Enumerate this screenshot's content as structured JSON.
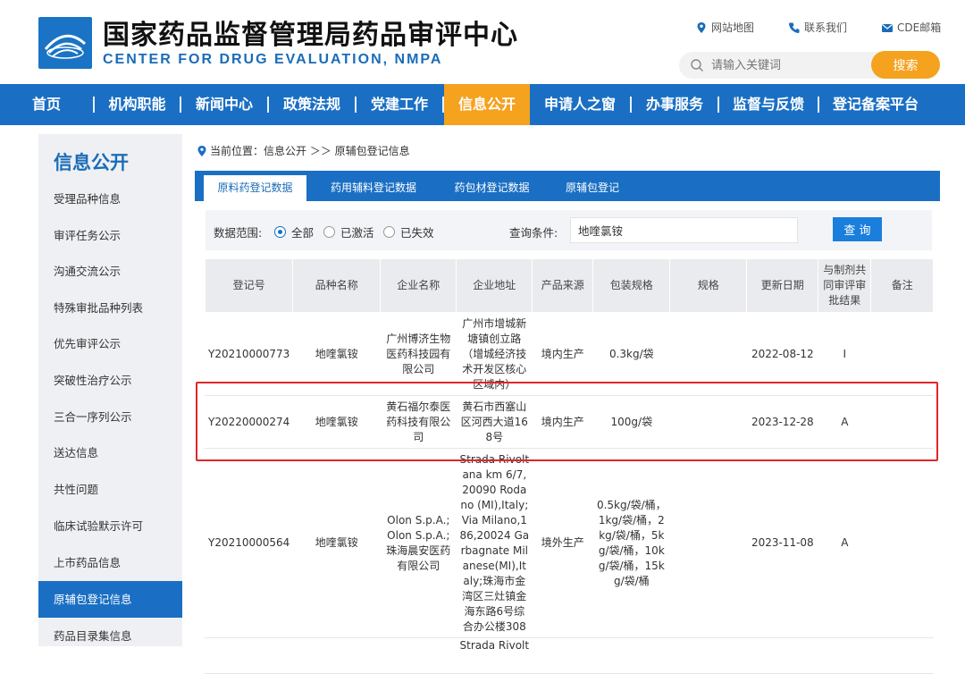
{
  "header": {
    "title_cn": "国家药品监督管理局药品审评中心",
    "title_en": "CENTER FOR DRUG EVALUATION, NMPA",
    "links": [
      {
        "label": "网站地图",
        "icon": "location-pin-icon"
      },
      {
        "label": "联系我们",
        "icon": "phone-icon"
      },
      {
        "label": "CDE邮箱",
        "icon": "mail-icon"
      }
    ],
    "search": {
      "placeholder": "请输入关键词",
      "button": "搜索"
    }
  },
  "nav": {
    "items": [
      "首页",
      "机构职能",
      "新闻中心",
      "政策法规",
      "党建工作",
      "信息公开",
      "申请人之窗",
      "办事服务",
      "监督与反馈",
      "登记备案平台"
    ],
    "active": "信息公开"
  },
  "sidebar": {
    "title": "信息公开",
    "items": [
      "受理品种信息",
      "审评任务公示",
      "沟通交流公示",
      "特殊审批品种列表",
      "优先审评公示",
      "突破性治疗公示",
      "三合一序列公示",
      "送达信息",
      "共性问题",
      "临床试验默示许可",
      "上市药品信息",
      "原辅包登记信息",
      "药品目录集信息"
    ],
    "active": "原辅包登记信息"
  },
  "breadcrumb": {
    "prefix": "当前位置：",
    "path": "信息公开 ＞＞ 原辅包登记信息"
  },
  "tabs": [
    "原料药登记数据",
    "药用辅料登记数据",
    "药包材登记数据",
    "原辅包登记"
  ],
  "filter": {
    "scope_label": "数据范围:",
    "options": [
      "全部",
      "已激活",
      "已失效"
    ],
    "selected": "全部",
    "query_label": "查询条件:",
    "query_value": "地喹氯铵",
    "query_button": "查 询"
  },
  "table": {
    "headers": [
      "登记号",
      "品种名称",
      "企业名称",
      "企业地址",
      "产品来源",
      "包装规格",
      "规格",
      "更新日期",
      "与制剂共同审评审批结果",
      "备注"
    ],
    "rows": [
      [
        "Y20210000773",
        "地喹氯铵",
        "广州博济生物医药科技园有限公司",
        "广州市增城新塘镇创立路（增城经济技术开发区核心区域内）",
        "境内生产",
        "0.3kg/袋",
        "",
        "2022-08-12",
        "I",
        ""
      ],
      [
        "Y20220000274",
        "地喹氯铵",
        "黄石福尔泰医药科技有限公司",
        "黄石市西塞山区河西大道168号",
        "境内生产",
        "100g/袋",
        "",
        "2023-12-28",
        "A",
        ""
      ],
      [
        "Y20210000564",
        "地喹氯铵",
        "Olon S.p.A.;Olon S.p.A.;珠海晨安医药有限公司",
        "Strada Rivoltana km 6/7,20090 Rodano (MI),Italy;Via Milano,186,20024 Garbagnate Milanese(MI),Italy;珠海市金湾区三灶镇金海东路6号综合办公楼308",
        "境外生产",
        "0.5kg/袋/桶，1kg/袋/桶，2kg/袋/桶，5kg/袋/桶，10kg/袋/桶，15kg/袋/桶",
        "",
        "2023-11-08",
        "A",
        ""
      ],
      [
        "",
        "",
        "",
        "Strada Rivolt",
        "",
        "",
        "",
        "",
        "",
        ""
      ]
    ]
  }
}
